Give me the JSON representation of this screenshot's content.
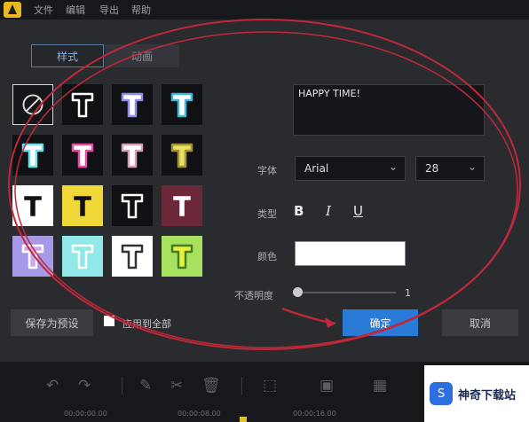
{
  "menubar": {
    "items": [
      "文件",
      "编辑",
      "导出",
      "帮助"
    ]
  },
  "tabs": {
    "style": "样式",
    "animation": "动画"
  },
  "text_value": "HAPPY TIME!",
  "labels": {
    "font": "字体",
    "type": "类型",
    "color": "颜色",
    "opacity": "不透明度"
  },
  "font": {
    "family": "Arial",
    "size": "28"
  },
  "format": {
    "bold": "B",
    "italic": "I",
    "underline": "U"
  },
  "opacity_value": "1",
  "buttons": {
    "save_preset": "保存为预设",
    "apply_all": "应用到全部",
    "ok": "确定",
    "cancel": "取消"
  },
  "timeline": {
    "times": [
      "00:00:00.00",
      "00:00:08.00",
      "00:00:16.00"
    ]
  },
  "watermark": {
    "logo": "S",
    "text": "神奇下载站"
  },
  "colors": {
    "accent": "#2a7ad8",
    "annotation": "#c0283a",
    "text_color": "#ffffff"
  }
}
